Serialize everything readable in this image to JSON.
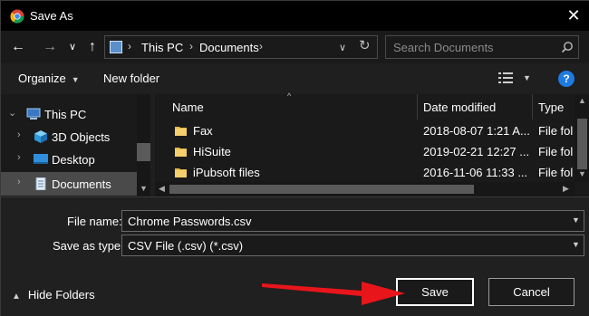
{
  "window": {
    "title": "Save As",
    "close_glyph": "✕"
  },
  "nav": {
    "back_glyph": "←",
    "forward_glyph": "→",
    "recent_glyph": "∨",
    "up_glyph": "↑",
    "breadcrumbs": [
      "This PC",
      "Documents"
    ],
    "crumb_separator": "›",
    "refresh_glyph": "↻",
    "search": {
      "placeholder": "Search Documents",
      "icon": "search-icon"
    }
  },
  "toolbar": {
    "organize_label": "Organize",
    "new_folder_label": "New folder",
    "help_label": "?"
  },
  "sidebar": {
    "items": [
      {
        "label": "This PC",
        "icon": "pc-icon",
        "expanded": true
      },
      {
        "label": "3D Objects",
        "icon": "cube-icon"
      },
      {
        "label": "Desktop",
        "icon": "desktop-icon"
      },
      {
        "label": "Documents",
        "icon": "documents-icon",
        "selected": true
      }
    ]
  },
  "files": {
    "columns": [
      "Name",
      "Date modified",
      "Type"
    ],
    "rows": [
      {
        "name": "Fax",
        "date": "2018-08-07 1:21 A...",
        "type": "File fol"
      },
      {
        "name": "HiSuite",
        "date": "2019-02-21 12:27 ...",
        "type": "File fol"
      },
      {
        "name": "iPubsoft files",
        "date": "2016-11-06 11:33 ...",
        "type": "File fol"
      }
    ]
  },
  "form": {
    "file_name_label": "File name:",
    "file_name_value": "Chrome Passwords.csv",
    "save_type_label": "Save as type:",
    "save_type_value": "CSV File (.csv) (*.csv)"
  },
  "footer": {
    "hide_folders_label": "Hide Folders",
    "save_label": "Save",
    "cancel_label": "Cancel"
  },
  "colors": {
    "folder": "#e8b84a",
    "arrow": "#e8151b",
    "help": "#1e7be0",
    "selected": "#4a4a4a"
  }
}
